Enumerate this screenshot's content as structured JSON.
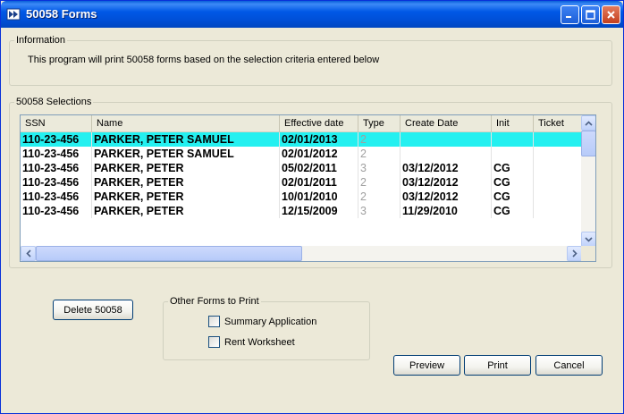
{
  "window": {
    "title": "50058 Forms"
  },
  "info": {
    "legend": "Information",
    "text": "This program will print 50058 forms based on the selection criteria entered below"
  },
  "selections": {
    "legend": "50058 Selections",
    "columns": [
      "SSN",
      "Name",
      "Effective date",
      "Type",
      "Create Date",
      "Init",
      "Ticket"
    ],
    "rows": [
      {
        "ssn": "110-23-456",
        "name": "PARKER, PETER SAMUEL",
        "effective_date": "02/01/2013",
        "type": "2",
        "create_date": "",
        "init": "",
        "ticket": ""
      },
      {
        "ssn": "110-23-456",
        "name": "PARKER, PETER SAMUEL",
        "effective_date": "02/01/2012",
        "type": "2",
        "create_date": "",
        "init": "",
        "ticket": ""
      },
      {
        "ssn": "110-23-456",
        "name": "PARKER, PETER",
        "effective_date": "05/02/2011",
        "type": "3",
        "create_date": "03/12/2012",
        "init": "CG",
        "ticket": ""
      },
      {
        "ssn": "110-23-456",
        "name": "PARKER, PETER",
        "effective_date": "02/01/2011",
        "type": "2",
        "create_date": "03/12/2012",
        "init": "CG",
        "ticket": ""
      },
      {
        "ssn": "110-23-456",
        "name": "PARKER, PETER",
        "effective_date": "10/01/2010",
        "type": "2",
        "create_date": "03/12/2012",
        "init": "CG",
        "ticket": ""
      },
      {
        "ssn": "110-23-456",
        "name": "PARKER, PETER",
        "effective_date": "12/15/2009",
        "type": "3",
        "create_date": "11/29/2010",
        "init": "CG",
        "ticket": ""
      }
    ],
    "selected_row": 0,
    "selected_color": "#24f0f0"
  },
  "buttons": {
    "delete": "Delete 50058",
    "preview": "Preview",
    "print": "Print",
    "cancel": "Cancel"
  },
  "other_forms": {
    "legend": "Other Forms to Print",
    "options": [
      {
        "label": "Summary Application",
        "checked": false
      },
      {
        "label": "Rent Worksheet",
        "checked": false
      }
    ]
  }
}
